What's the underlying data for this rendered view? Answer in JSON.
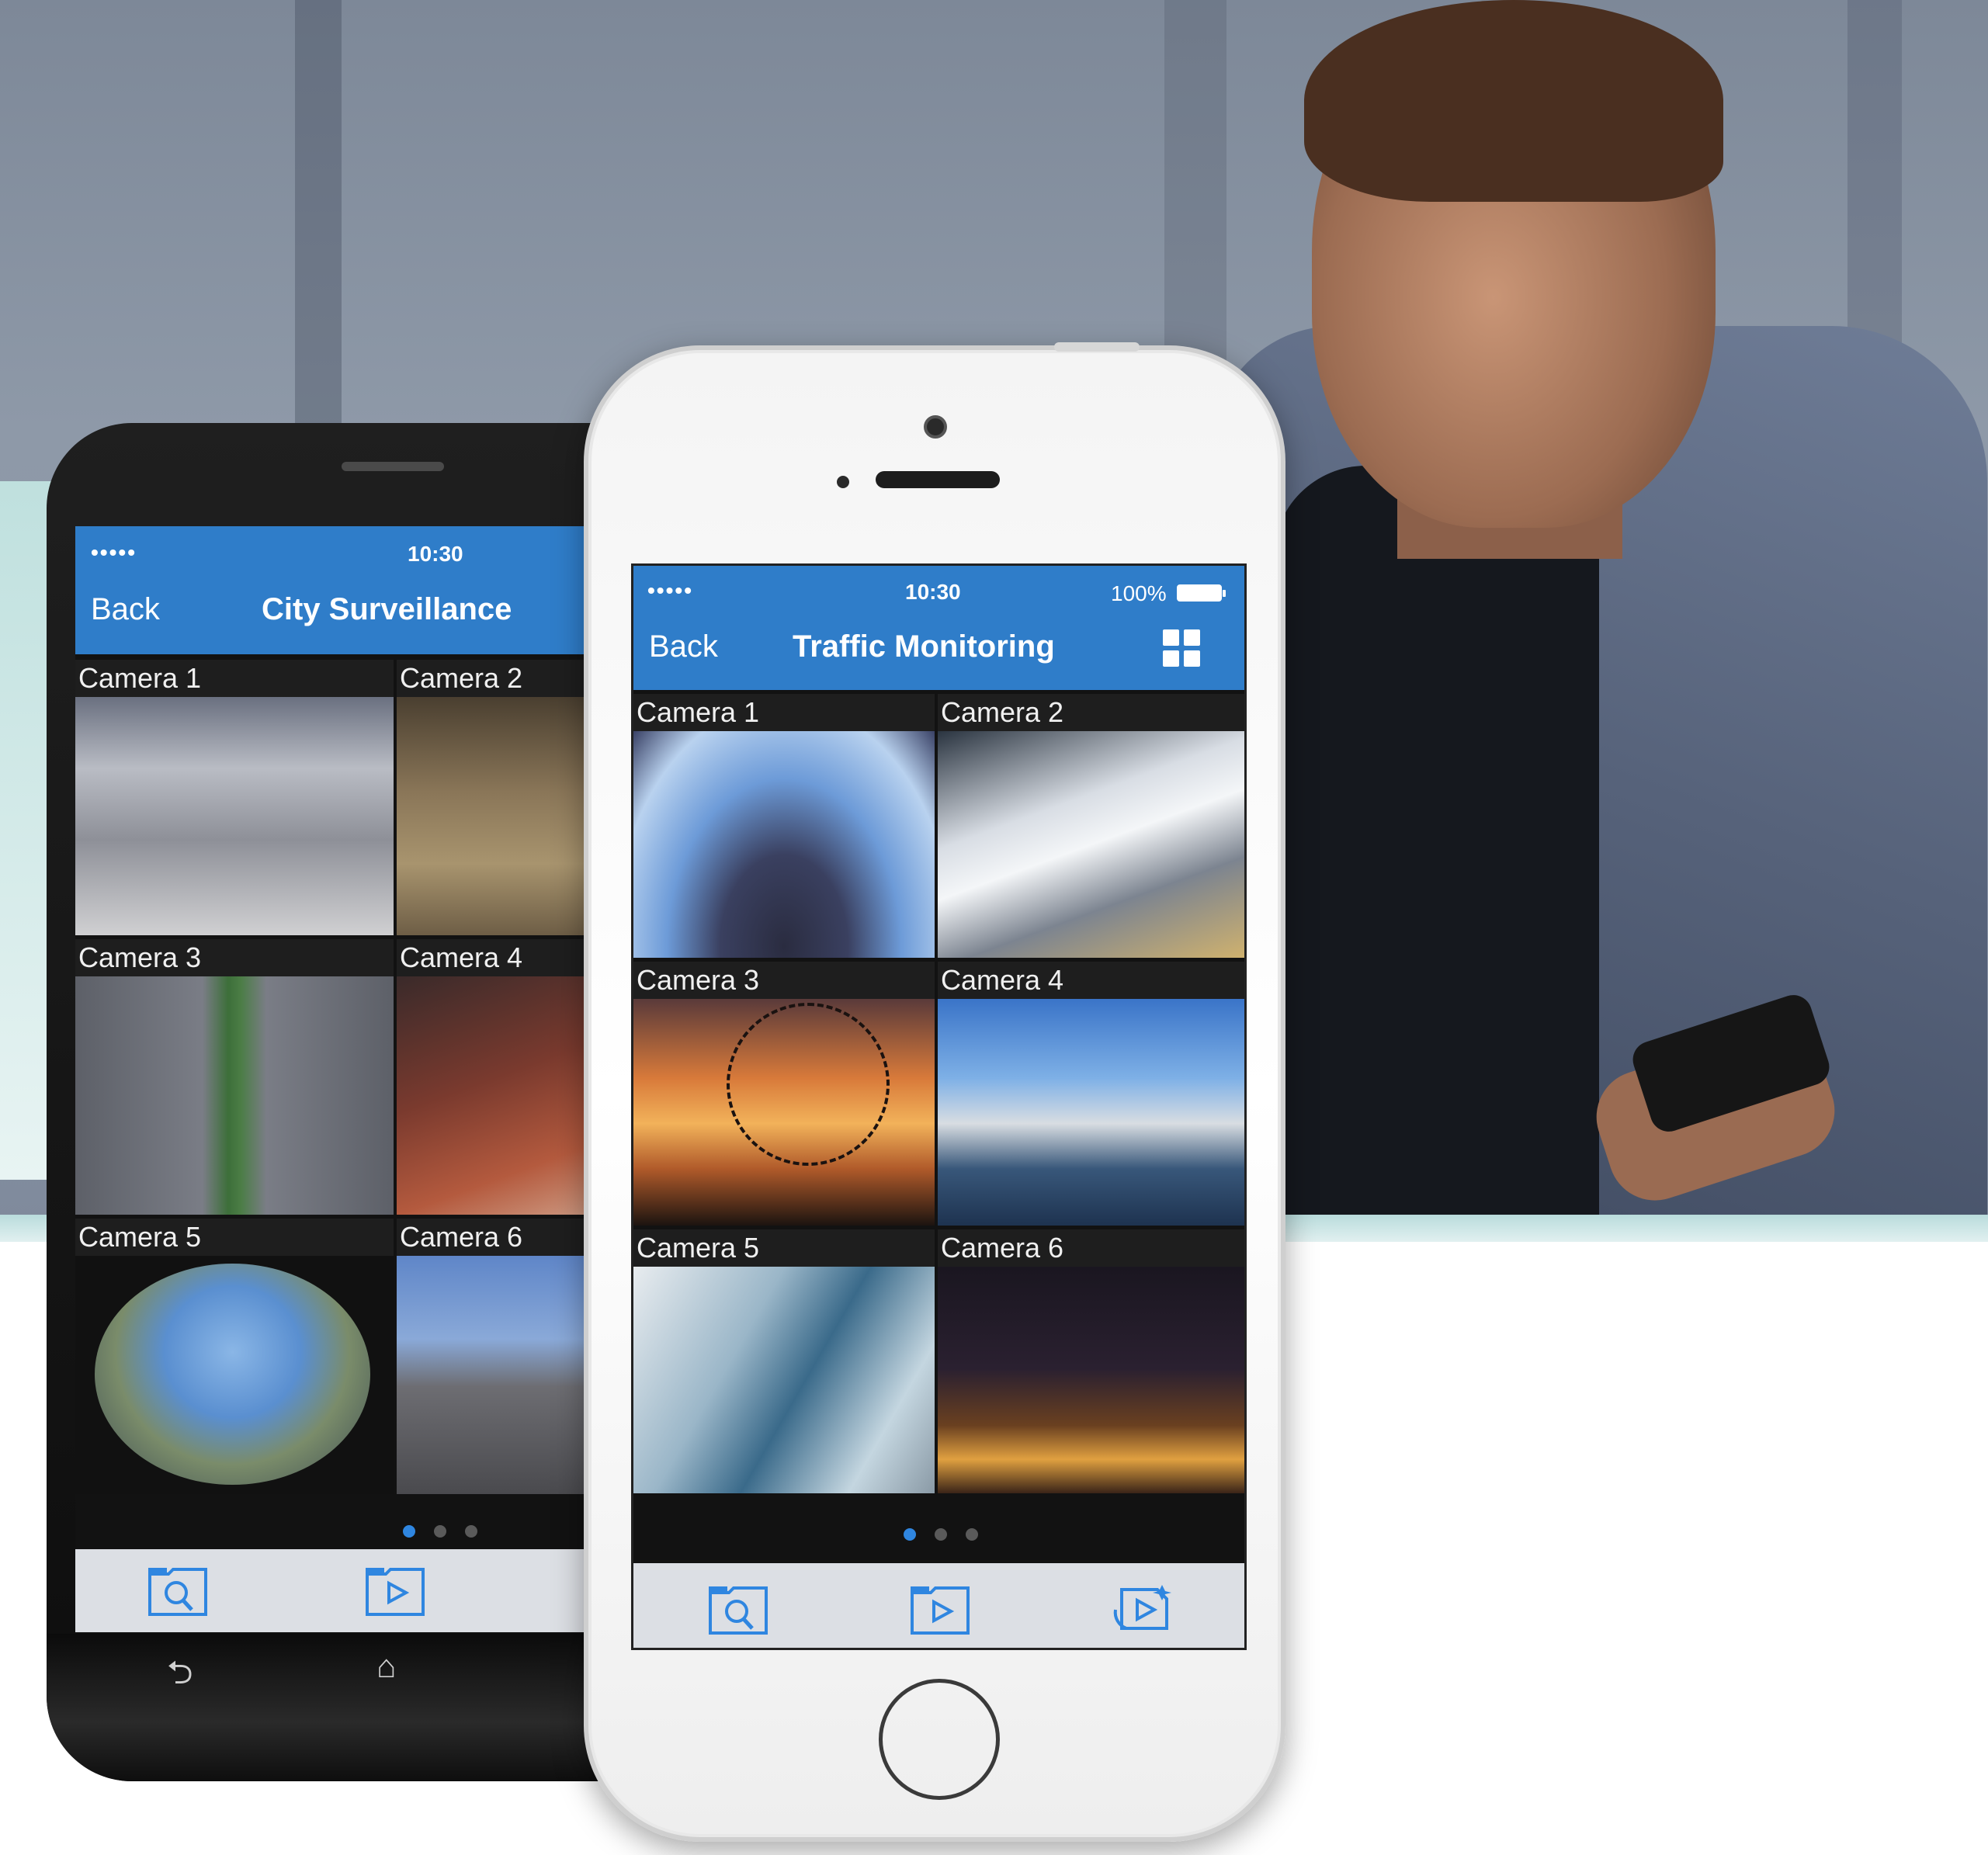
{
  "colors": {
    "nav_blue": "#2f7dc9",
    "dot_active": "#2f86e0",
    "toolbar_bg": "#dcdfe4",
    "icon_blue": "#2f86e0"
  },
  "android": {
    "status": {
      "signal": "•••••",
      "time": "10:30"
    },
    "nav": {
      "back": "Back",
      "title": "City Surveillance"
    },
    "cameras": [
      {
        "label": "Camera 1",
        "scene": "airport-crowd"
      },
      {
        "label": "Camera 2",
        "scene": "station-hall"
      },
      {
        "label": "Camera 3",
        "scene": "highway-traffic"
      },
      {
        "label": "Camera 4",
        "scene": "city-street-traffic"
      },
      {
        "label": "Camera 5",
        "scene": "fisheye-city"
      },
      {
        "label": "Camera 6",
        "scene": "building-plaza"
      }
    ],
    "page_dots": {
      "count": 3,
      "active": 1
    },
    "toolbar": [
      "search-folder-icon",
      "playback-folder-icon"
    ],
    "system_keys": {
      "back": "⮌",
      "home": "⌂"
    }
  },
  "iphone": {
    "status": {
      "signal": "•••••",
      "time": "10:30",
      "battery": "100%"
    },
    "nav": {
      "back": "Back",
      "title": "Traffic Monitoring",
      "layout_icon": "grid-layout-icon"
    },
    "cameras": [
      {
        "label": "Camera 1",
        "scene": "eiffel-tower"
      },
      {
        "label": "Camera 2",
        "scene": "bullet-train"
      },
      {
        "label": "Camera 3",
        "scene": "ferris-wheel-sunset"
      },
      {
        "label": "Camera 4",
        "scene": "marina-boats"
      },
      {
        "label": "Camera 5",
        "scene": "glass-building"
      },
      {
        "label": "Camera 6",
        "scene": "night-bridge"
      }
    ],
    "page_dots": {
      "count": 3,
      "active": 1
    },
    "toolbar": [
      "search-folder-icon",
      "playback-folder-icon",
      "sync-playback-icon"
    ]
  }
}
